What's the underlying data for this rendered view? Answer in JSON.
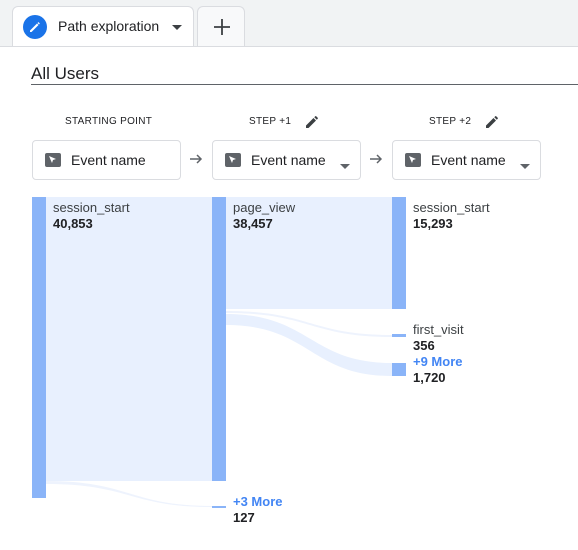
{
  "tab": {
    "label": "Path exploration",
    "icon": "pencil-circle-icon"
  },
  "segment": {
    "label": "All Users"
  },
  "steps": [
    {
      "header": "STARTING POINT",
      "dimension": "Event name"
    },
    {
      "header": "STEP +1",
      "dimension": "Event name"
    },
    {
      "header": "STEP +2",
      "dimension": "Event name"
    }
  ],
  "nodes": {
    "start": {
      "name": "session_start",
      "count": "40,853"
    },
    "step1_page_view": {
      "name": "page_view",
      "count": "38,457"
    },
    "step1_more": {
      "more": "+3 More",
      "count": "127"
    },
    "step2_session_start": {
      "name": "session_start",
      "count": "15,293"
    },
    "step2_first_visit": {
      "name": "first_visit",
      "count": "356"
    },
    "step2_more": {
      "more": "+9 More",
      "count": "1,720"
    }
  },
  "colors": {
    "node": "#8ab4f8",
    "flow": "#e8f0fe",
    "link": "#4285f4",
    "accent": "#1a73e8"
  }
}
